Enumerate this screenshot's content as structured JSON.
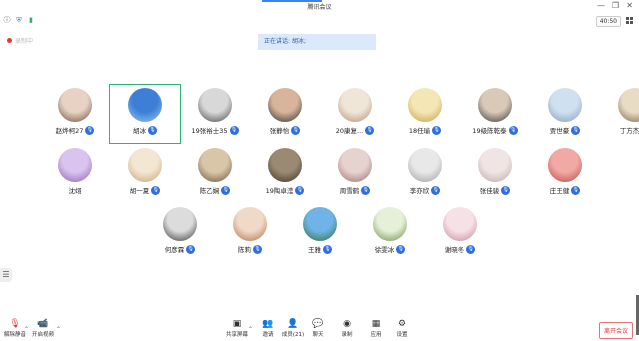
{
  "window": {
    "title": "腾讯会议",
    "controls": [
      "—",
      "❐",
      "✕"
    ]
  },
  "topbar": {
    "timer": "40:50"
  },
  "recording": {
    "label": "录制中"
  },
  "speaking": {
    "prefix": "正在讲话:",
    "name": "胡冰;"
  },
  "participants": [
    {
      "name": "赵烨柯27",
      "mic": true,
      "colors": [
        "#e7d2c3",
        "#6b4a3a"
      ]
    },
    {
      "name": "胡冰",
      "mic": true,
      "selected": true,
      "colors": [
        "#3d7fd6",
        "#9cc8f2"
      ]
    },
    {
      "name": "19张裕士35",
      "mic": true,
      "colors": [
        "#d8d8d8",
        "#444"
      ]
    },
    {
      "name": "张静怡",
      "mic": true,
      "colors": [
        "#d7b49a",
        "#2b2b2b"
      ]
    },
    {
      "name": "20康复...",
      "mic": true,
      "colors": [
        "#efe6d8",
        "#b48b72"
      ]
    },
    {
      "name": "18任瑜",
      "mic": true,
      "colors": [
        "#f5e7b5",
        "#c59a43"
      ]
    },
    {
      "name": "19级陈乾泰",
      "mic": true,
      "colors": [
        "#d9c9b8",
        "#333"
      ]
    },
    {
      "name": "贾世豪",
      "mic": true,
      "colors": [
        "#cfe0f0",
        "#7d9bb8"
      ]
    },
    {
      "name": "丁方杰",
      "mic": true,
      "colors": [
        "#e9dcc5",
        "#7a6245"
      ]
    },
    {
      "name": "沈翊",
      "mic": false,
      "colors": [
        "#d8c4ee",
        "#8a5bb4"
      ]
    },
    {
      "name": "胡一夏",
      "mic": true,
      "colors": [
        "#f3e6d2",
        "#c6a073"
      ]
    },
    {
      "name": "陈乙娴",
      "mic": true,
      "colors": [
        "#d9c5a8",
        "#6a5238"
      ]
    },
    {
      "name": "19陶卓滢",
      "mic": true,
      "colors": [
        "#9a8a73",
        "#3a2e22"
      ]
    },
    {
      "name": "周雪鹤",
      "mic": true,
      "colors": [
        "#e6d3d0",
        "#9c6b66"
      ]
    },
    {
      "name": "李亦欣",
      "mic": true,
      "colors": [
        "#e8e8e8",
        "#9b9b9b"
      ]
    },
    {
      "name": "张佳骏",
      "mic": true,
      "colors": [
        "#f0e4e4",
        "#bfa5a5"
      ]
    },
    {
      "name": "庄王健",
      "mic": true,
      "colors": [
        "#f0a9a4",
        "#c0413c"
      ]
    },
    {
      "name": "何彦霖",
      "mic": true,
      "colors": [
        "#dcdcdc",
        "#333"
      ]
    },
    {
      "name": "陈莉",
      "mic": true,
      "colors": [
        "#f1d9c7",
        "#b06b3f"
      ]
    },
    {
      "name": "王雅",
      "mic": true,
      "colors": [
        "#6fb3e8",
        "#2f6f2f"
      ]
    },
    {
      "name": "徐雯冰",
      "mic": true,
      "colors": [
        "#e6f0d8",
        "#6b8a42"
      ]
    },
    {
      "name": "谢晓冬",
      "mic": true,
      "colors": [
        "#f6e2e6",
        "#c9869a"
      ]
    }
  ],
  "toolbar": {
    "unmute": "解除静音",
    "start_video": "开启视频",
    "share_screen": "共享屏幕",
    "invite": "邀请",
    "members": "成员(21)",
    "chat": "聊天",
    "record": "录制",
    "apps": "应用",
    "settings": "设置",
    "leave": "离开会议"
  },
  "icons": {
    "unmute": "mic-muted-icon",
    "video": "video-off-icon",
    "share": "share-screen-icon",
    "invite": "invite-icon",
    "members": "members-icon",
    "chat": "chat-icon",
    "record": "record-icon",
    "apps": "apps-icon",
    "settings": "gear-icon"
  }
}
